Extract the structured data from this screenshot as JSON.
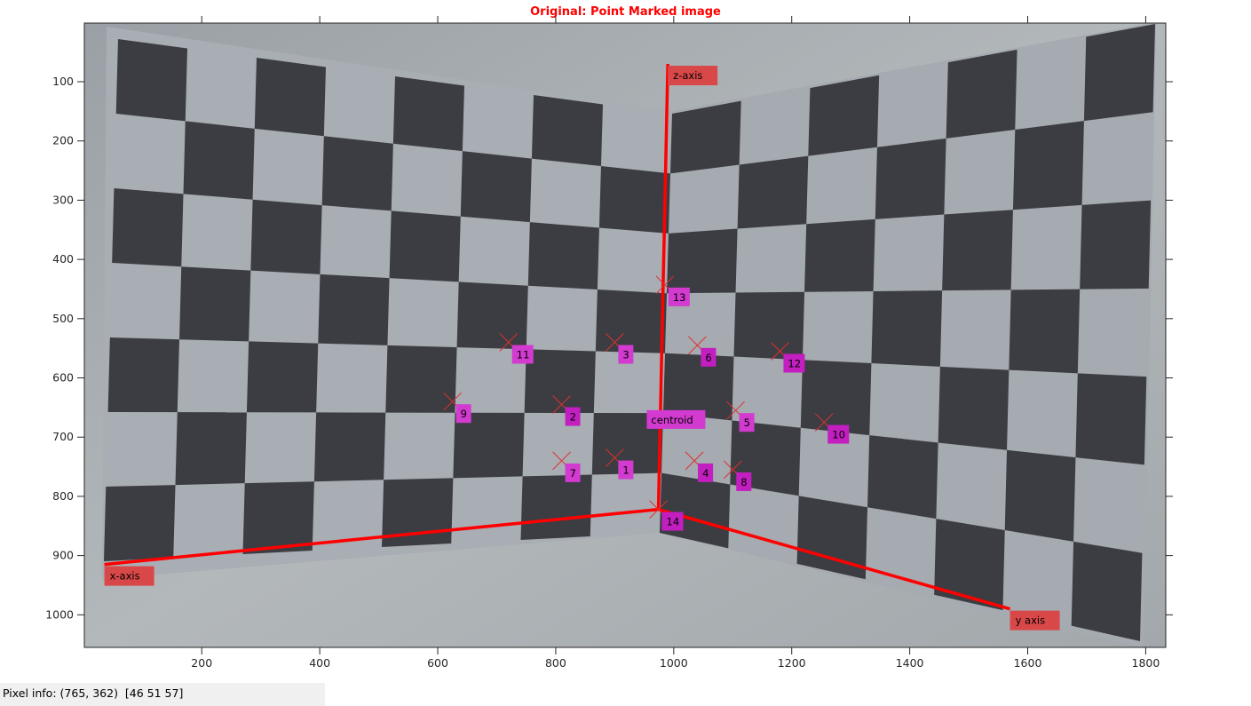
{
  "window": {
    "title": "Original: Point Marked image"
  },
  "status": {
    "label": "Pixel info:",
    "coords": "(765, 362)",
    "rgb": "[46 51 57]"
  },
  "axes": {
    "x_ticks": [
      "200",
      "400",
      "600",
      "800",
      "1000",
      "1200",
      "1400",
      "1600",
      "1800"
    ],
    "y_ticks": [
      "100",
      "200",
      "300",
      "400",
      "500",
      "600",
      "700",
      "800",
      "900",
      "1000"
    ],
    "x_values": [
      200,
      400,
      600,
      800,
      1000,
      1200,
      1400,
      1600,
      1800
    ],
    "y_values": [
      100,
      200,
      300,
      400,
      500,
      600,
      700,
      800,
      900,
      1000
    ],
    "x_range": [
      1,
      1834
    ],
    "y_range": [
      1,
      1055
    ]
  },
  "colors": {
    "axis_line": "#ff0000",
    "axis_label_bg": "#d94848",
    "marker": "#e03030",
    "label_bg_a": "#c21ec0",
    "label_bg_b": "#d23ad0",
    "dark_square": "#3b3d42",
    "light_square": "#a8abb3"
  },
  "axis_lines": [
    {
      "name": "z-axis",
      "label": "z-axis",
      "from": [
        974,
        822
      ],
      "to": [
        990,
        70
      ]
    },
    {
      "name": "x-axis",
      "label": "x-axis",
      "from": [
        974,
        822
      ],
      "to": [
        35,
        915
      ]
    },
    {
      "name": "y-axis",
      "label": "y axis",
      "from": [
        974,
        822
      ],
      "to": [
        1570,
        990
      ]
    }
  ],
  "points": [
    {
      "label": "1",
      "x": 900,
      "y": 735
    },
    {
      "label": "2",
      "x": 810,
      "y": 645
    },
    {
      "label": "3",
      "x": 900,
      "y": 540
    },
    {
      "label": "4",
      "x": 1035,
      "y": 740
    },
    {
      "label": "5",
      "x": 1105,
      "y": 655
    },
    {
      "label": "6",
      "x": 1040,
      "y": 545
    },
    {
      "label": "7",
      "x": 810,
      "y": 740
    },
    {
      "label": "8",
      "x": 1100,
      "y": 755
    },
    {
      "label": "9",
      "x": 625,
      "y": 640
    },
    {
      "label": "10",
      "x": 1255,
      "y": 675
    },
    {
      "label": "11",
      "x": 720,
      "y": 540
    },
    {
      "label": "12",
      "x": 1180,
      "y": 555
    },
    {
      "label": "13",
      "x": 985,
      "y": 443
    },
    {
      "label": "14",
      "x": 974,
      "y": 822
    }
  ],
  "centroid": {
    "label": "centroid",
    "x": 1025,
    "y": 668
  }
}
